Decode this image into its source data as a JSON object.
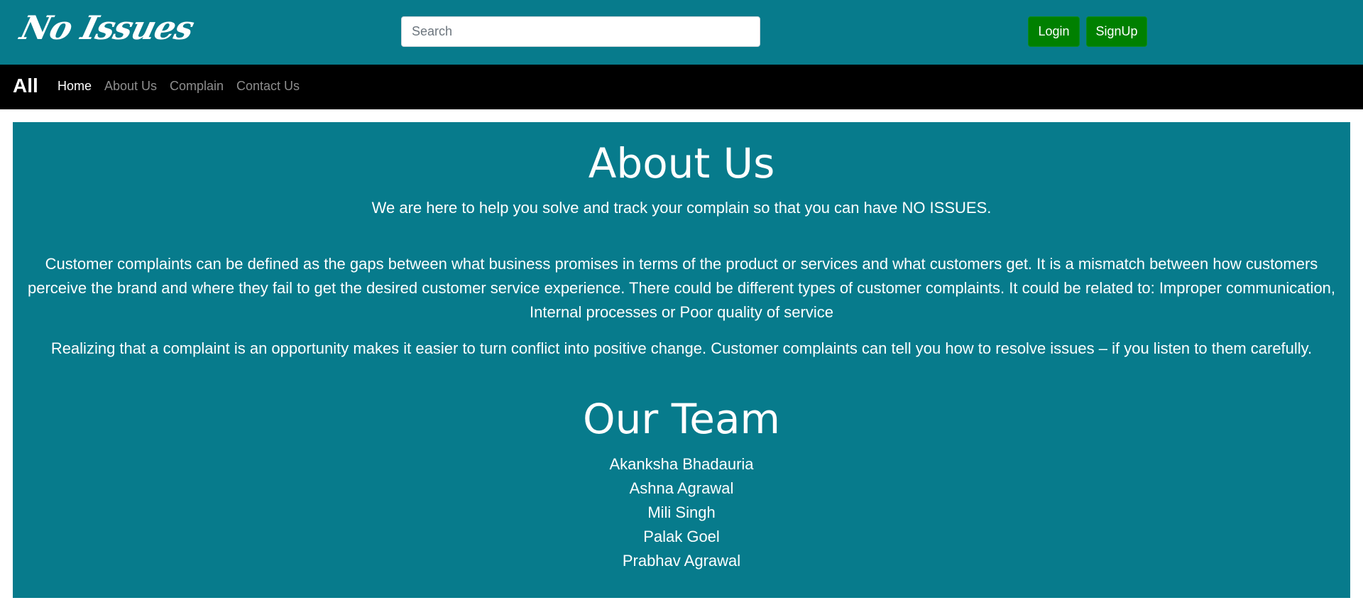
{
  "header": {
    "logo": "No Issues",
    "search": {
      "placeholder": "Search",
      "value": ""
    },
    "login_label": "Login",
    "signup_label": "SignUp"
  },
  "nav": {
    "brand": "All",
    "items": [
      {
        "label": "Home",
        "active": true
      },
      {
        "label": "About Us",
        "active": false
      },
      {
        "label": "Complain",
        "active": false
      },
      {
        "label": "Contact Us",
        "active": false
      }
    ]
  },
  "about": {
    "title": "About Us",
    "tagline": "We are here to help you solve and track your complain so that you can have NO ISSUES.",
    "paragraph1": "Customer complaints can be defined as the gaps between what business promises in terms of the product or services and what customers get. It is a mismatch between how customers perceive the brand and where they fail to get the desired customer service experience. There could be different types of customer complaints. It could be related to: Improper communication, Internal processes or Poor quality of service",
    "paragraph2": "Realizing that a complaint is an opportunity makes it easier to turn conflict into positive change. Customer complaints can tell you how to resolve issues – if you listen to them carefully."
  },
  "team": {
    "title": "Our Team",
    "members": [
      "Akanksha Bhadauria",
      "Ashna Agrawal",
      "Mili Singh",
      "Palak Goel",
      "Prabhav Agrawal"
    ]
  },
  "colors": {
    "primary_teal": "#077b8c",
    "button_green": "#008000",
    "navbar_black": "#000000"
  }
}
